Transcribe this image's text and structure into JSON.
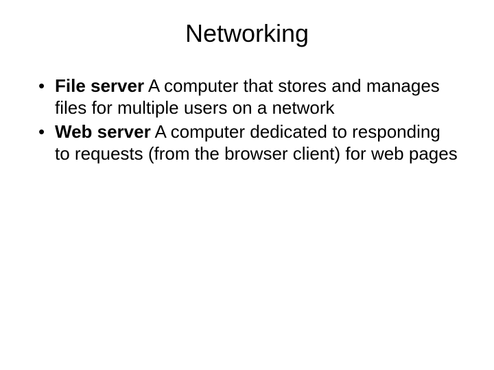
{
  "title": "Networking",
  "bullets": [
    {
      "term": "File server",
      "definition": "  A computer that stores and manages files for multiple users on a network"
    },
    {
      "term": "Web server",
      "definition": "  A computer dedicated to responding to requests (from the browser client) for web pages"
    }
  ]
}
